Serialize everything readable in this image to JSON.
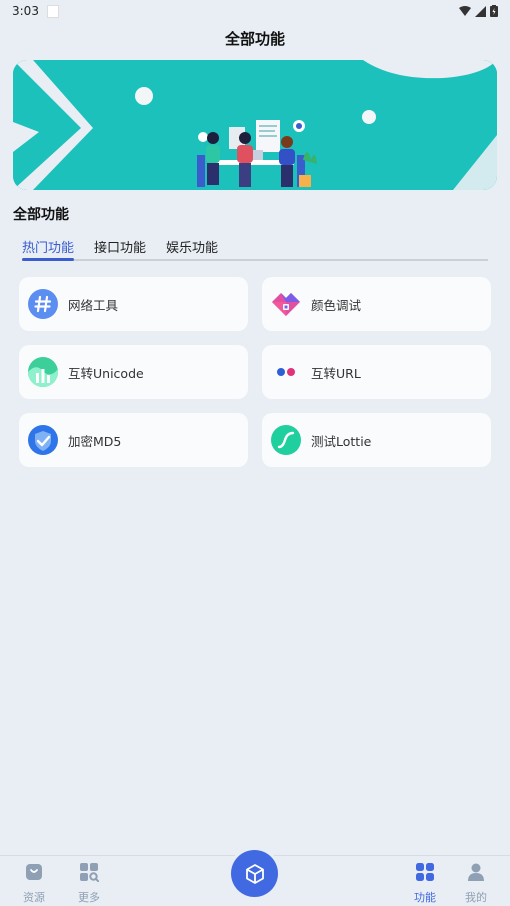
{
  "status": {
    "time": "3:03"
  },
  "header": {
    "title": "全部功能"
  },
  "section": {
    "title": "全部功能"
  },
  "tabs": [
    {
      "label": "热门功能",
      "active": true
    },
    {
      "label": "接口功能",
      "active": false
    },
    {
      "label": "娱乐功能",
      "active": false
    }
  ],
  "features": [
    {
      "label": "网络工具",
      "icon": "hash-icon"
    },
    {
      "label": "颜色调试",
      "icon": "color-palette-icon"
    },
    {
      "label": "互转Unicode",
      "icon": "unicode-chart-icon"
    },
    {
      "label": "互转URL",
      "icon": "url-dots-icon"
    },
    {
      "label": "加密MD5",
      "icon": "shield-check-icon"
    },
    {
      "label": "测试Lottie",
      "icon": "lottie-icon"
    }
  ],
  "nav": {
    "resources": "资源",
    "more": "更多",
    "features": "功能",
    "mine": "我的"
  },
  "colors": {
    "accent": "#4169e1",
    "banner": "#1cc1bb",
    "background": "#e8eef4"
  }
}
